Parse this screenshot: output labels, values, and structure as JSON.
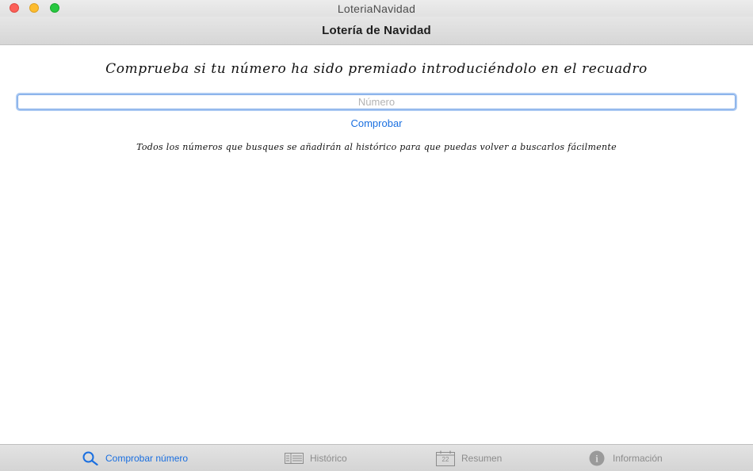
{
  "window": {
    "title": "LoteriaNavidad"
  },
  "navbar": {
    "title": "Lotería de Navidad"
  },
  "main": {
    "heading": "Comprueba si tu número ha sido premiado introduciéndolo en el recuadro",
    "input": {
      "value": "",
      "placeholder": "Número"
    },
    "check_button_label": "Comprobar",
    "info_text": "Todos los números que busques se añadirán al histórico para que puedas volver a buscarlos fácilmente"
  },
  "tabbar": {
    "tabs": [
      {
        "label": "Comprobar número",
        "icon": "search-icon",
        "active": true
      },
      {
        "label": "Histórico",
        "icon": "list-icon",
        "active": false
      },
      {
        "label": "Resumen",
        "icon": "calendar-icon",
        "active": false
      },
      {
        "label": "Información",
        "icon": "info-icon",
        "active": false
      }
    ],
    "calendar_day": "22"
  },
  "colors": {
    "accent": "#1a6fe0",
    "inactive": "#8c8c8c",
    "close": "#fc5f57",
    "minimize": "#fdbc2e",
    "maximize": "#27c840"
  }
}
